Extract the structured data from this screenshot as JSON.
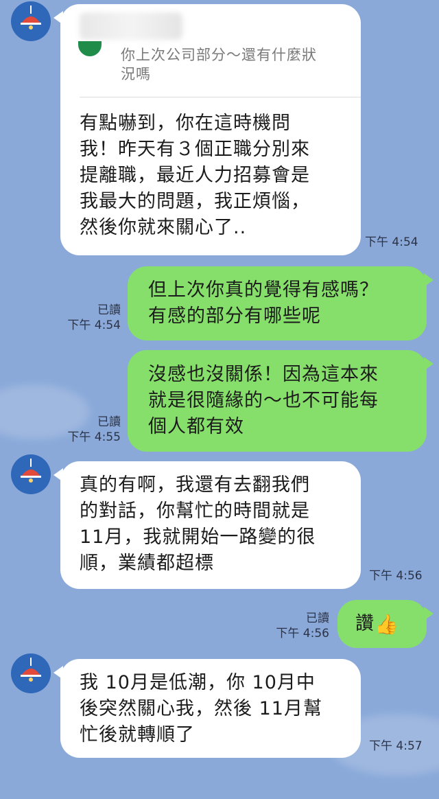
{
  "colors": {
    "background": "#8aa9d9",
    "incoming": "#ffffff",
    "outgoing": "#86df6a",
    "avatar": "#2f67b9",
    "lamp": "#e24a3b"
  },
  "messages": [
    {
      "direction": "in",
      "reply_quote": [
        "你上次公司部分～還有什麼狀",
        "況嗎"
      ],
      "lines": [
        "有點嚇到，你在這時機問",
        "我！昨天有３個正職分別來",
        "提離職，最近人力招募會是",
        "我最大的問題，我正煩惱，",
        "然後你就來關心了.."
      ],
      "time": "下午 4:54"
    },
    {
      "direction": "out",
      "lines": [
        "但上次你真的覺得有感嗎？",
        "有感的部分有哪些呢"
      ],
      "read": "已讀",
      "time": "下午 4:54"
    },
    {
      "direction": "out",
      "lines": [
        "沒感也沒關係！因為這本來",
        "就是很隨緣的～也不可能每",
        "個人都有效"
      ],
      "read": "已讀",
      "time": "下午 4:55"
    },
    {
      "direction": "in",
      "lines": [
        "真的有啊，我還有去翻我們",
        "的對話，你幫忙的時間就是",
        "11月，我就開始一路變的很",
        "順，業績都超標"
      ],
      "time": "下午 4:56"
    },
    {
      "direction": "out",
      "lines": [
        "讚"
      ],
      "emoji": "👍",
      "read": "已讀",
      "time": "下午 4:56"
    },
    {
      "direction": "in",
      "lines": [
        "我 10月是低潮，你 10月中",
        "後突然關心我，然後 11月幫",
        "忙後就轉順了"
      ],
      "time": "下午 4:57"
    }
  ]
}
